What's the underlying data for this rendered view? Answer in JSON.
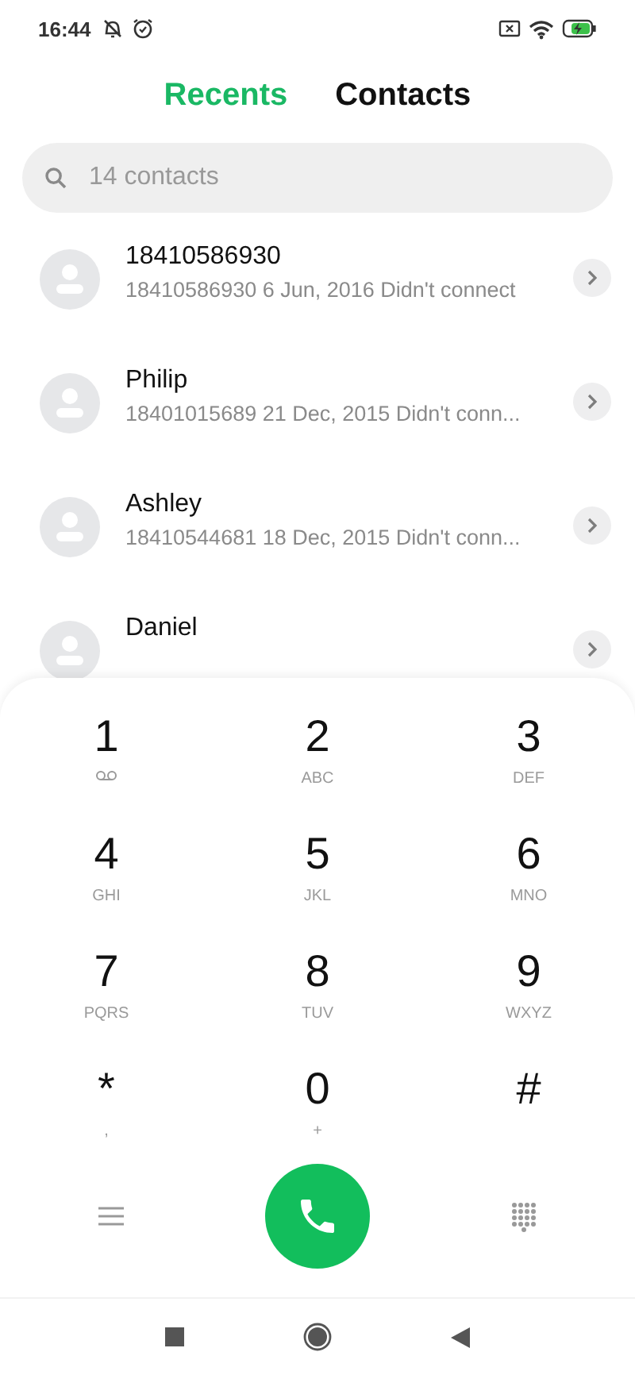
{
  "status_bar": {
    "time": "16:44"
  },
  "tabs": [
    {
      "label": "Recents",
      "selected": true
    },
    {
      "label": "Contacts",
      "selected": false
    }
  ],
  "search": {
    "placeholder": "14 contacts"
  },
  "calls": [
    {
      "name": "18410586930",
      "detail": "18410586930  6 Jun, 2016 Didn't connect"
    },
    {
      "name": "Philip",
      "detail": "18401015689  21 Dec, 2015 Didn't conn..."
    },
    {
      "name": "Ashley",
      "detail": "18410544681  18 Dec, 2015 Didn't conn..."
    },
    {
      "name": "Daniel"
    }
  ],
  "keys": [
    {
      "digit": "1",
      "kind": "voicemail"
    },
    {
      "digit": "2",
      "letters": "ABC",
      "kind": "letters"
    },
    {
      "digit": "3",
      "letters": "DEF",
      "kind": "letters"
    },
    {
      "digit": "4",
      "letters": "GHI",
      "kind": "letters"
    },
    {
      "digit": "5",
      "letters": "JKL",
      "kind": "letters"
    },
    {
      "digit": "6",
      "letters": "MNO",
      "kind": "letters"
    },
    {
      "digit": "7",
      "letters": "PQRS",
      "kind": "letters"
    },
    {
      "digit": "8",
      "letters": "TUV",
      "kind": "letters"
    },
    {
      "digit": "9",
      "letters": "WXYZ",
      "kind": "letters"
    },
    {
      "digit": "*",
      "letters": ",",
      "kind": "letters"
    },
    {
      "digit": "0",
      "letters": "+",
      "kind": "letters"
    },
    {
      "digit": "#",
      "kind": "plain"
    }
  ]
}
